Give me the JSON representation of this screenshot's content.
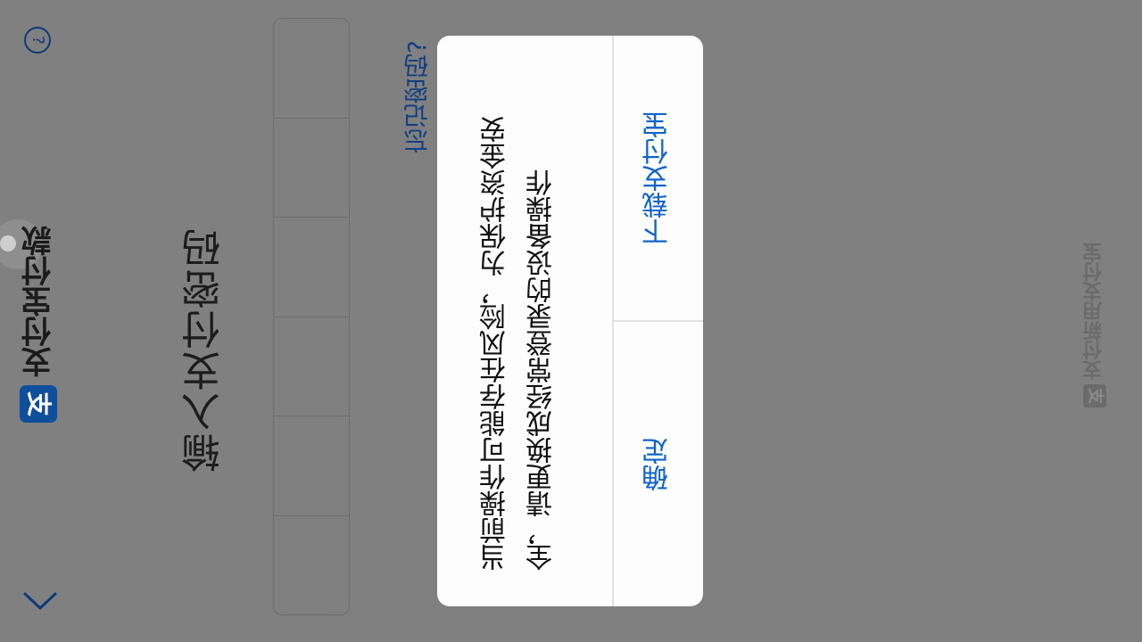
{
  "header": {
    "brand_logo_glyph": "支",
    "brand_title": "支付宝付款",
    "help_icon_glyph": "?"
  },
  "main": {
    "title": "输入支付密码",
    "pin_cells": 6,
    "forgot_password_label": "忘记密码?"
  },
  "watermark": {
    "logo_glyph": "支",
    "text": "支付新用支付宝"
  },
  "dialog": {
    "message": "当前操作可能存在风险，为保护资金安全，请更换成经常登录的设备操作",
    "download_button_label": "下载支付宝",
    "confirm_button_label": "确定"
  },
  "colors": {
    "overlay": "#808080",
    "link": "#1065c8",
    "brand": "#0e4f9b"
  }
}
